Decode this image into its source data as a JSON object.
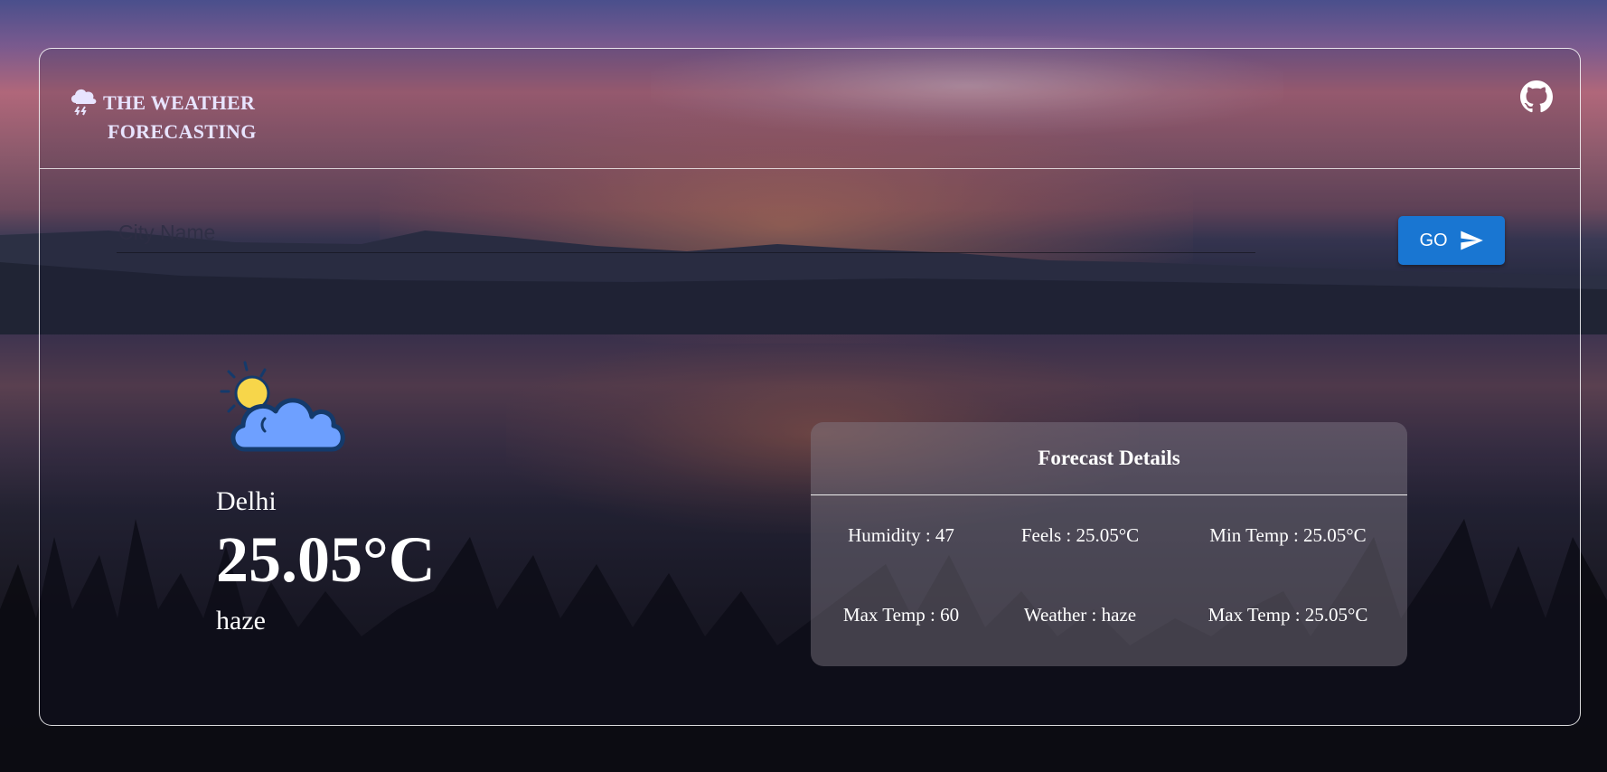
{
  "header": {
    "title_line1": "THE WEATHER",
    "title_line2": "FORECASTING",
    "brand_icon": "cloud-storm-icon",
    "github_icon": "github-icon"
  },
  "search": {
    "placeholder": "City Name",
    "value": "",
    "button_label": "GO",
    "button_icon": "send-icon",
    "accent_color": "#1976d2"
  },
  "current": {
    "icon": "partly-cloudy-icon",
    "city": "Delhi",
    "temperature": "25.05°C",
    "description": "haze"
  },
  "forecast": {
    "title": "Forecast Details",
    "items": [
      "Humidity : 47",
      "Feels : 25.05°C",
      "Min Temp : 25.05°C",
      "Max Temp : 60",
      "Weather : haze",
      "Max Temp : 25.05°C"
    ]
  }
}
